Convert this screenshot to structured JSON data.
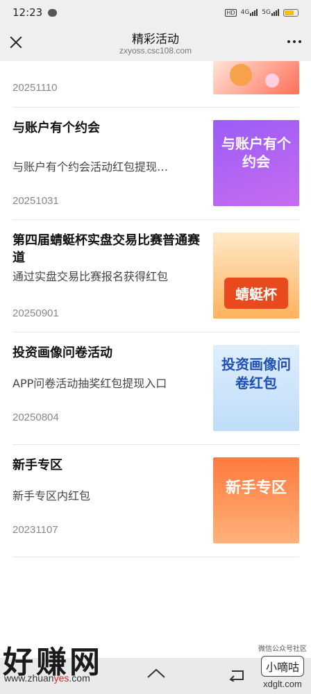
{
  "status_bar": {
    "time": "12:23",
    "network1": "4G",
    "network2": "5G",
    "hd": "HD"
  },
  "header": {
    "title": "精彩活动",
    "subtitle": "zxyoss.csc108.com"
  },
  "items": [
    {
      "title": "",
      "desc": "",
      "date": "20251110",
      "image_text": ""
    },
    {
      "title": "与账户有个约会",
      "desc": "与账户有个约会活动红包提现…",
      "date": "20251031",
      "image_text": "与账户有个约会"
    },
    {
      "title": "第四届蜻蜓杯实盘交易比赛普通赛道",
      "desc": "通过实盘交易比赛报名获得红包",
      "date": "20250901",
      "image_text": "蜻蜓杯"
    },
    {
      "title": "投资画像问卷活动",
      "desc": "APP问卷活动抽奖红包提现入口",
      "date": "20250804",
      "image_text": "投资画像问卷红包"
    },
    {
      "title": "新手专区",
      "desc": "新手专区内红包",
      "date": "20231107",
      "image_text": "新手专区"
    }
  ],
  "watermark": {
    "left_text": "好赚网",
    "url_prefix": "www.zhuan",
    "url_red": "yes",
    "url_suffix": ".com",
    "right_small": "微信公众号社区",
    "right_badge": "小嘀咕",
    "right_url": "xdglt.com"
  }
}
